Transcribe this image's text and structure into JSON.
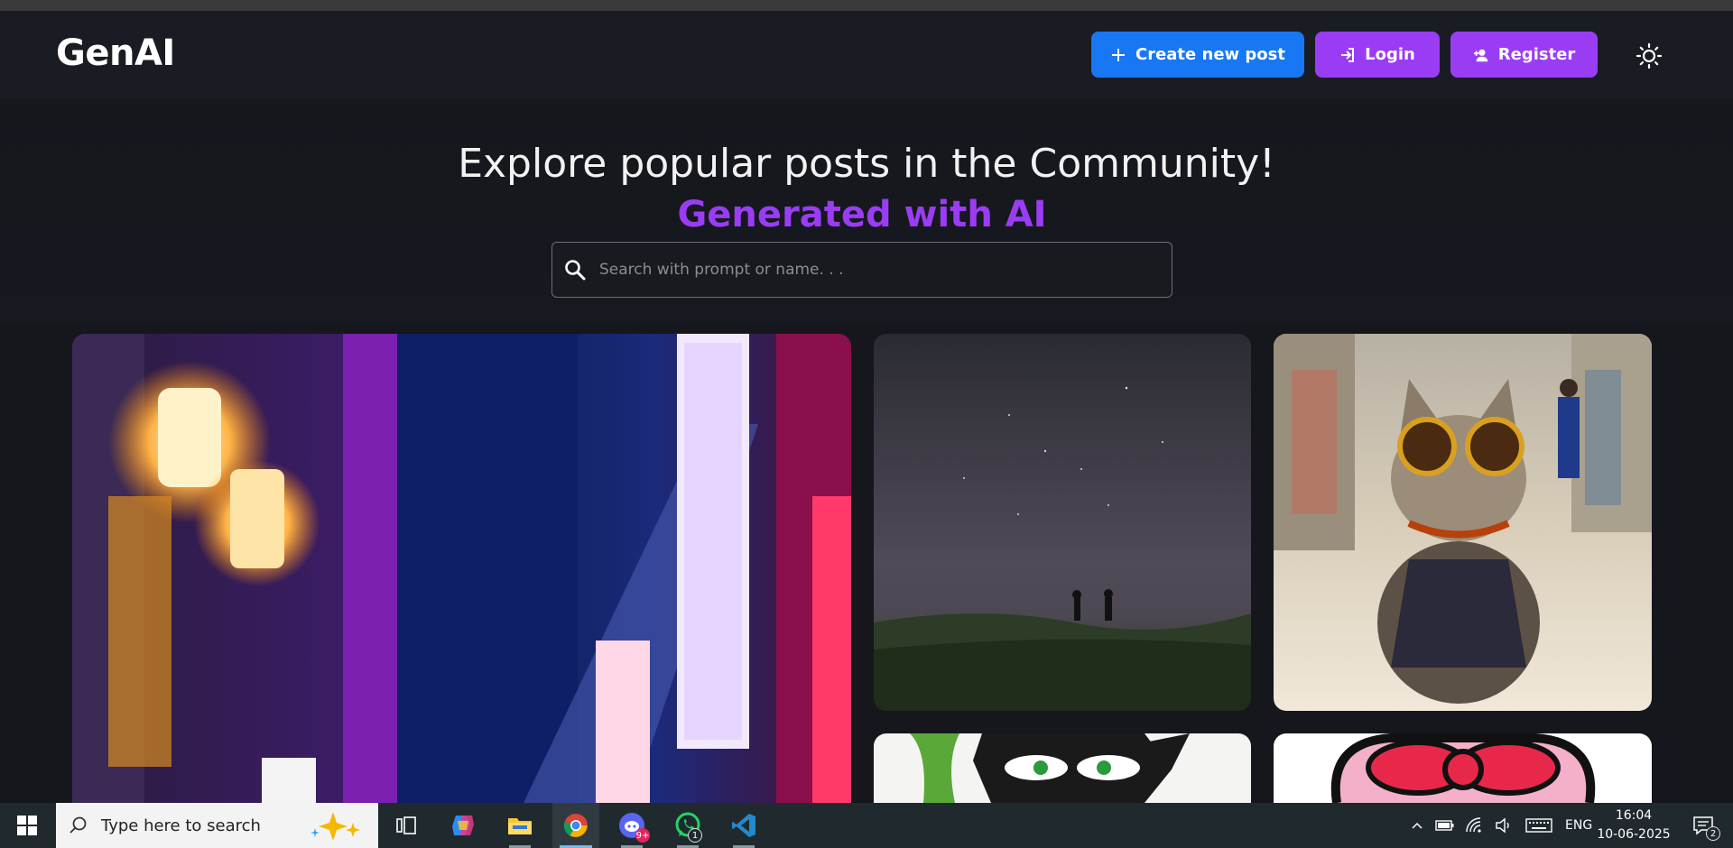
{
  "app": {
    "logo": "GenAI"
  },
  "nav": {
    "create_label": "Create new post",
    "login_label": "Login",
    "register_label": "Register"
  },
  "hero": {
    "title": "Explore popular posts in the Community!",
    "subtitle": "Generated with AI"
  },
  "search": {
    "placeholder": "Search with prompt or name. . ."
  },
  "colors": {
    "page_bg": "#15171d",
    "navbar_bg": "#1a1c23",
    "primary": "#1877f2",
    "accent": "#9b3cf5"
  },
  "posts": [
    {
      "image": "neon-city-alley"
    },
    {
      "image": "night-sky-field-silhouettes"
    },
    {
      "image": "cat-with-sunglasses-mall"
    },
    {
      "image": "masked-cartoon-hero"
    },
    {
      "image": "cartoon-red-bow"
    }
  ],
  "taskbar": {
    "search_placeholder": "Type here to search",
    "apps": [
      "task-view",
      "copilot",
      "file-explorer",
      "chrome",
      "discord",
      "whatsapp",
      "vscode"
    ],
    "discord_badge": "9+",
    "whatsapp_badge": "1",
    "language": "ENG",
    "time": "16:04",
    "date": "10-06-2025",
    "notification_count": "2"
  }
}
